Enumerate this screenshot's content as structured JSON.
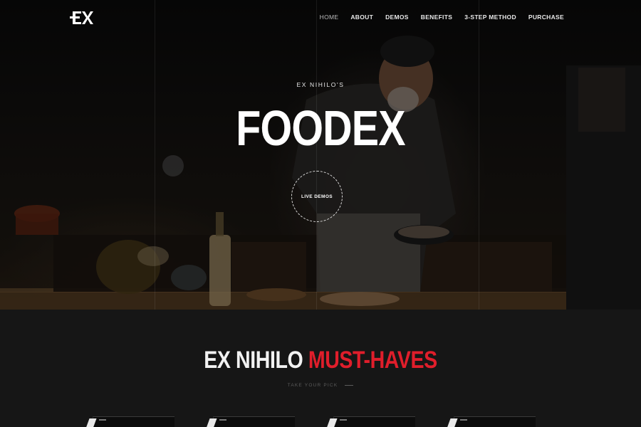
{
  "header": {
    "logo_text": "EX",
    "nav": [
      {
        "label": "HOME",
        "active": true
      },
      {
        "label": "ABOUT"
      },
      {
        "label": "DEMOS"
      },
      {
        "label": "BENEFITS"
      },
      {
        "label": "3-STEP METHOD"
      },
      {
        "label": "PURCHASE"
      }
    ]
  },
  "hero": {
    "eyebrow": "EX NIHILO'S",
    "title": "FOODEX",
    "cta_label": "LIVE DEMOS"
  },
  "section": {
    "title_white": "EX NIHILO",
    "title_red": "MUST-HAVES",
    "subtitle": "TAKE YOUR PICK"
  },
  "colors": {
    "accent_red": "#e01e2b",
    "background": "#161616"
  }
}
